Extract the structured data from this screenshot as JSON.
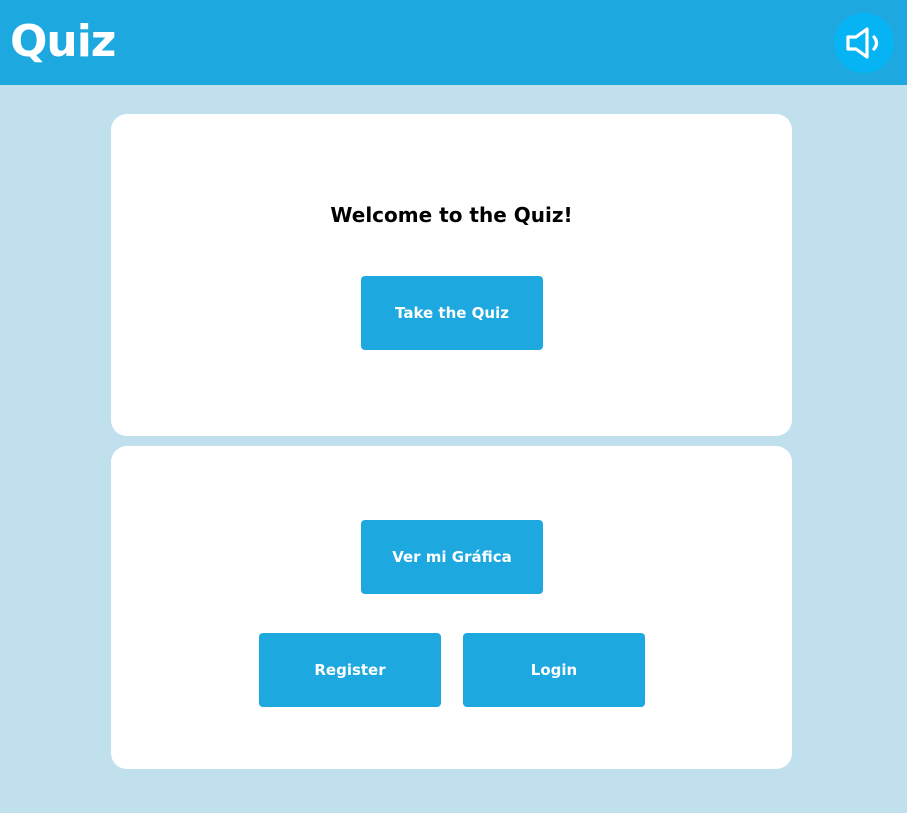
{
  "header": {
    "title": "Quiz",
    "sound_icon": "speaker-volume-icon",
    "background_color": "#1ea8e0",
    "sound_button_color": "#06b4f3"
  },
  "welcome_card": {
    "heading": "Welcome to the Quiz!",
    "take_quiz_label": "Take the Quiz"
  },
  "actions_card": {
    "grafica_label": "Ver mi Gráfica",
    "register_label": "Register",
    "login_label": "Login"
  },
  "colors": {
    "page_background": "#c1e0ee",
    "card_background": "#ffffff",
    "button_background": "#1ea8e0",
    "button_text": "#ffffff"
  }
}
